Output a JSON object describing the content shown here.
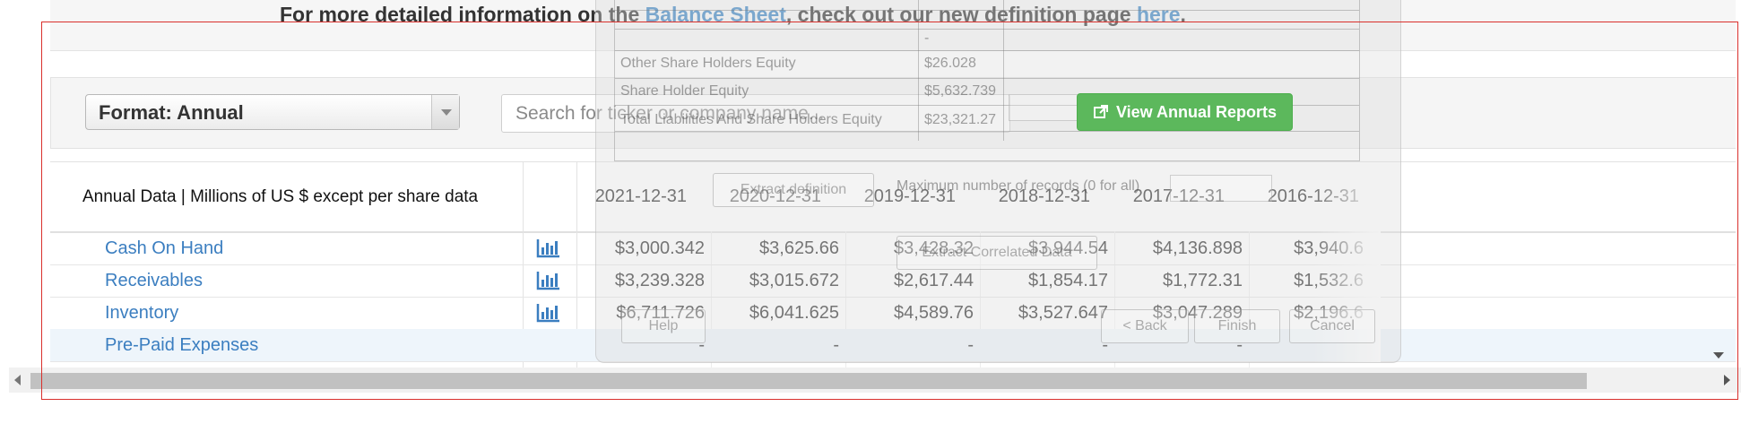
{
  "banner": {
    "prefix": "For more detailed information on the ",
    "link1": "Balance Sheet",
    "middle": ", check out our new definition page ",
    "link2": "here",
    "suffix": "."
  },
  "toolbar": {
    "format_label": "Format: Annual",
    "search_placeholder": "Search for ticker or company name...",
    "view_reports_label": "View Annual Reports",
    "view_reports_icon": "external-link-icon",
    "view_reports_color": "#5cb85c"
  },
  "table": {
    "header_title": "Annual Data | Millions of US $ except per share data",
    "dates": [
      "2021-12-31",
      "2020-12-31",
      "2019-12-31",
      "2018-12-31",
      "2017-12-31",
      "2016-12-31"
    ],
    "rows": [
      {
        "label": "Cash On Hand",
        "icon": "bar-chart-icon",
        "values": [
          "$3,000.342",
          "$3,625.66",
          "$3,428.32",
          "$3,944.54",
          "$4,136.898",
          "$3,940.6"
        ]
      },
      {
        "label": "Receivables",
        "icon": "bar-chart-icon",
        "values": [
          "$3,239.328",
          "$3,015.672",
          "$2,617.44",
          "$1,854.17",
          "$1,772.31",
          "$1,532.6"
        ]
      },
      {
        "label": "Inventory",
        "icon": "bar-chart-icon",
        "values": [
          "$6,711.726",
          "$6,041.625",
          "$4,589.76",
          "$3,527.647",
          "$3,047.289",
          "$2,196.6"
        ]
      },
      {
        "label": "Pre-Paid Expenses",
        "icon": "",
        "values": [
          "-",
          "-",
          "-",
          "-",
          "-",
          ""
        ]
      }
    ],
    "link_color": "#3b7ec0",
    "highlight_row_color": "#eef5fb"
  },
  "ghost_dialog": {
    "rows": [
      {
        "label": "",
        "value": "-"
      },
      {
        "label": "Other Share Holders Equity",
        "value": "$26.028"
      },
      {
        "label": "Share Holder Equity",
        "value": "$5,632.739"
      },
      {
        "label": "Total Liabilities And Share Holders Equity",
        "value": "$23,321.27"
      }
    ],
    "extract_definition": "Extract definition",
    "max_records": "Maximum number of records (0 for all)",
    "extract_correlated": "Extract Correlated Data",
    "help": "Help",
    "back": "< Back",
    "finish": "Finish",
    "cancel": "Cancel"
  },
  "highlight_frame_color": "#d9302c"
}
